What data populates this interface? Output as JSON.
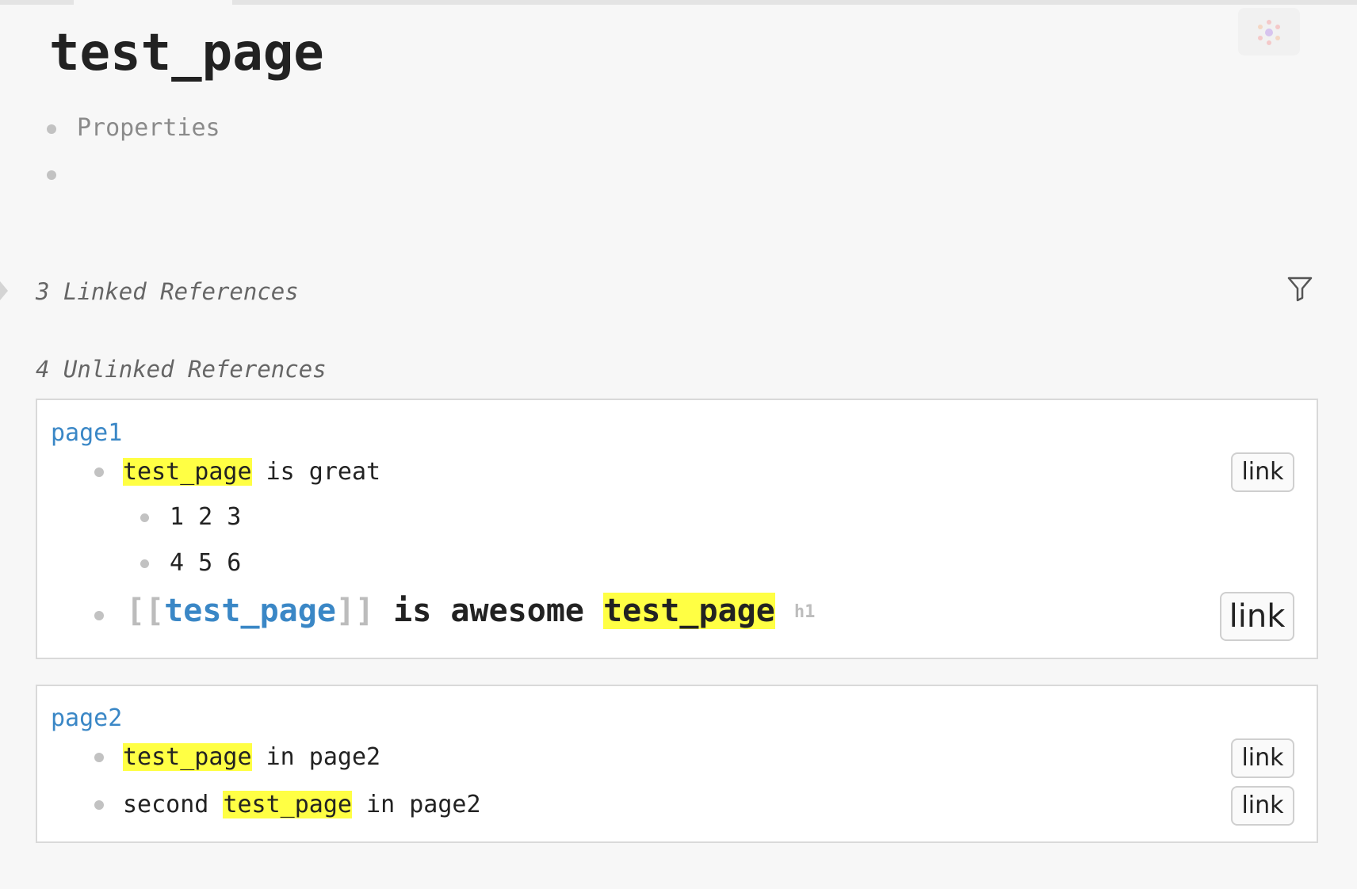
{
  "page": {
    "title": "test_page"
  },
  "properties": {
    "label": "Properties"
  },
  "linked_references": {
    "title": "3 Linked References"
  },
  "unlinked_references": {
    "title": "4 Unlinked References",
    "cards": [
      {
        "page_name": "page1",
        "blocks": [
          {
            "highlight": "test_page",
            "rest": " is great",
            "link_label": "link",
            "children": [
              "1 2 3",
              "4 5 6"
            ]
          },
          {
            "open_bracket": "[[",
            "ref": "test_page",
            "close_bracket": "]]",
            "middle": " is awesome ",
            "highlight": "test_page",
            "tag": "h1",
            "link_label": "link"
          }
        ]
      },
      {
        "page_name": "page2",
        "blocks": [
          {
            "highlight": "test_page",
            "rest": " in page2",
            "link_label": "link"
          },
          {
            "prefix": "second ",
            "highlight": "test_page",
            "rest": " in page2",
            "link_label": "link"
          }
        ]
      }
    ]
  },
  "icons": {
    "plugin": "plugin-dots-icon",
    "filter": "filter-icon",
    "collapse": "collapse-arrow-icon"
  },
  "colors": {
    "background": "#f7f7f7",
    "highlight": "#ffff44",
    "page_link": "#3a87c6",
    "card_background": "#ffffff",
    "bullet": "#c2c2c2"
  }
}
